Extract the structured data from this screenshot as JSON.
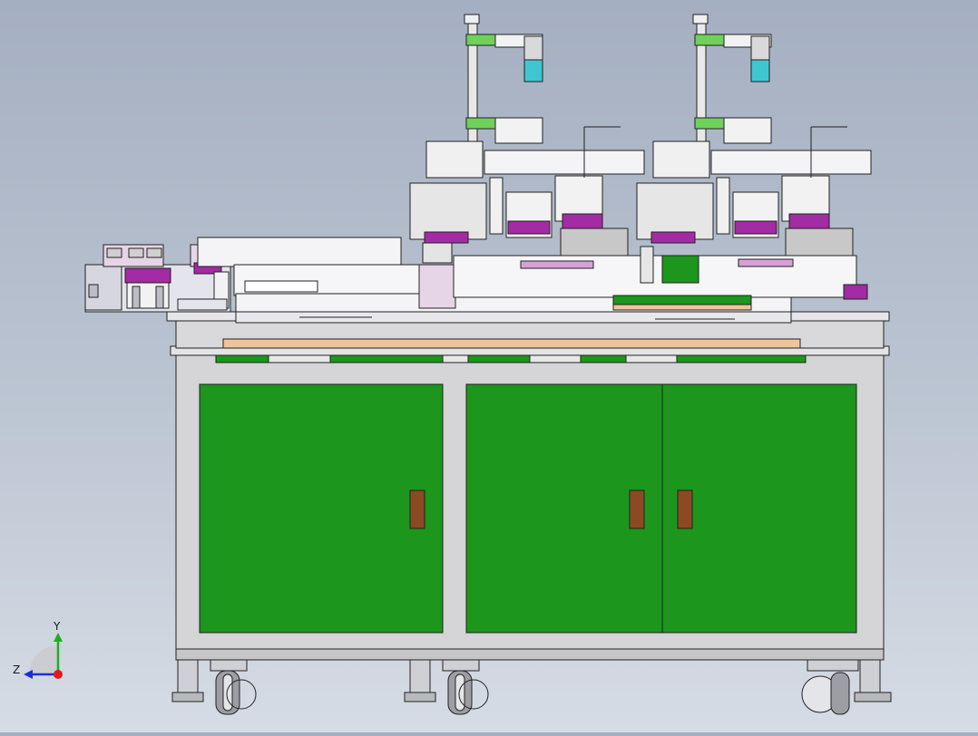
{
  "view": {
    "background_top": "#a4afc1",
    "background_bottom": "#d6dce5"
  },
  "colors": {
    "cabinet_frame": "#d5d5d7",
    "door_green": "#1c961c",
    "handle": "#8b4a22",
    "purple": "#a32ba3",
    "cyan": "#3fc6d1",
    "light_green": "#6fd15a",
    "plate": "#e6e6ea",
    "wood": "#f0c49a"
  },
  "triad": {
    "y_label": "Y",
    "z_label": "Z",
    "y_color": "#1fae1f",
    "z_color": "#1b2fd6",
    "origin_color": "#e01b1b"
  },
  "icons": {
    "triad": "view-orientation-triad-icon"
  }
}
